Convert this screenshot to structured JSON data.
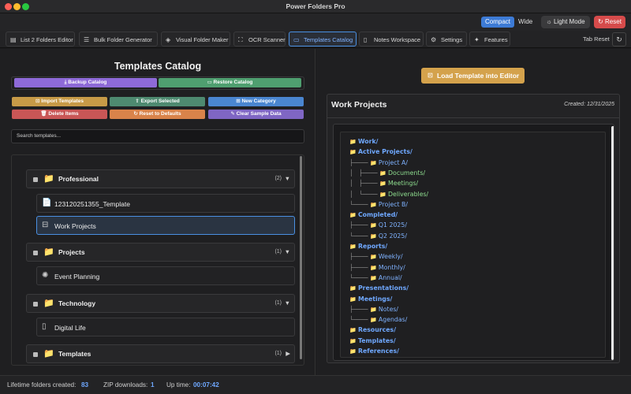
{
  "window": {
    "title": "Power Folders Pro"
  },
  "topbar": {
    "view_options": [
      "Compact",
      "Wide"
    ],
    "view_selected": "Compact",
    "light_mode_label": "Light Mode",
    "reset_label": "Reset"
  },
  "tabs": [
    {
      "label": "List 2 Folders Editor",
      "icon": "clipboard-icon"
    },
    {
      "label": "Bulk Folder Generator",
      "icon": "list-icon"
    },
    {
      "label": "Visual Folder Maker",
      "icon": "cube-icon"
    },
    {
      "label": "OCR Scanner",
      "icon": "scan-icon"
    },
    {
      "label": "Templates Catalog",
      "icon": "folder-icon",
      "active": true
    },
    {
      "label": "Notes Workspace",
      "icon": "notes-icon"
    },
    {
      "label": "Settings",
      "icon": "gear-icon"
    },
    {
      "label": "Features",
      "icon": "sparkles-icon"
    }
  ],
  "tab_reset_label": "Tab Reset",
  "left": {
    "title": "Templates Catalog",
    "backup_label": "Backup Catalog",
    "restore_label": "Restore Catalog",
    "import_label": "Import Templates",
    "export_label": "Export Selected",
    "new_category_label": "New Category",
    "delete_label": "Delete Items",
    "reset_defaults_label": "Reset to Defaults",
    "clear_sample_label": "Clear Sample Data",
    "search_placeholder": "Search templates...",
    "categories": [
      {
        "name": "Professional",
        "count": "(2)",
        "expanded": true,
        "items": [
          "123120251355_Template",
          "Work Projects"
        ]
      },
      {
        "name": "Projects",
        "count": "(1)",
        "expanded": true,
        "items": [
          "Event Planning"
        ]
      },
      {
        "name": "Technology",
        "count": "(1)",
        "expanded": true,
        "items": [
          "Digital Life"
        ]
      },
      {
        "name": "Templates",
        "count": "(1)",
        "expanded": false,
        "items": []
      }
    ],
    "selected_item": "Work Projects"
  },
  "right": {
    "load_button_label": "Load Template into Editor",
    "template_name": "Work Projects",
    "created": "Created: 12/31/2025",
    "tree": [
      {
        "prefix": "",
        "name": "Work/",
        "style": "b"
      },
      {
        "prefix": "",
        "name": "Active Projects/",
        "style": "b"
      },
      {
        "prefix": "├──── ",
        "name": "Project A/",
        "style": "l"
      },
      {
        "prefix": "│   ├──── ",
        "name": "Documents/",
        "style": "gr"
      },
      {
        "prefix": "│   ├──── ",
        "name": "Meetings/",
        "style": "gr"
      },
      {
        "prefix": "│   └──── ",
        "name": "Deliverables/",
        "style": "gr"
      },
      {
        "prefix": "└──── ",
        "name": "Project B/",
        "style": "l"
      },
      {
        "prefix": "",
        "name": "Completed/",
        "style": "b"
      },
      {
        "prefix": "├──── ",
        "name": "Q1 2025/",
        "style": "l"
      },
      {
        "prefix": "└──── ",
        "name": "Q2 2025/",
        "style": "l"
      },
      {
        "prefix": "",
        "name": "Reports/",
        "style": "b"
      },
      {
        "prefix": "├──── ",
        "name": "Weekly/",
        "style": "l"
      },
      {
        "prefix": "├──── ",
        "name": "Monthly/",
        "style": "l"
      },
      {
        "prefix": "└──── ",
        "name": "Annual/",
        "style": "l"
      },
      {
        "prefix": "",
        "name": "Presentations/",
        "style": "b"
      },
      {
        "prefix": "",
        "name": "Meetings/",
        "style": "b"
      },
      {
        "prefix": "├──── ",
        "name": "Notes/",
        "style": "l"
      },
      {
        "prefix": "└──── ",
        "name": "Agendas/",
        "style": "l"
      },
      {
        "prefix": "",
        "name": "Resources/",
        "style": "b"
      },
      {
        "prefix": "",
        "name": "Templates/",
        "style": "b"
      },
      {
        "prefix": "",
        "name": "References/",
        "style": "b"
      }
    ]
  },
  "status": {
    "lifetime_label": "Lifetime folders created:",
    "lifetime_value": "83",
    "zip_label": "ZIP downloads:",
    "zip_value": "1",
    "uptime_label": "Up time:",
    "uptime_value": "00:07:42"
  },
  "colors": {
    "accent": "#4a90e2",
    "reset": "#d64b4b",
    "load": "#d4a24c"
  }
}
